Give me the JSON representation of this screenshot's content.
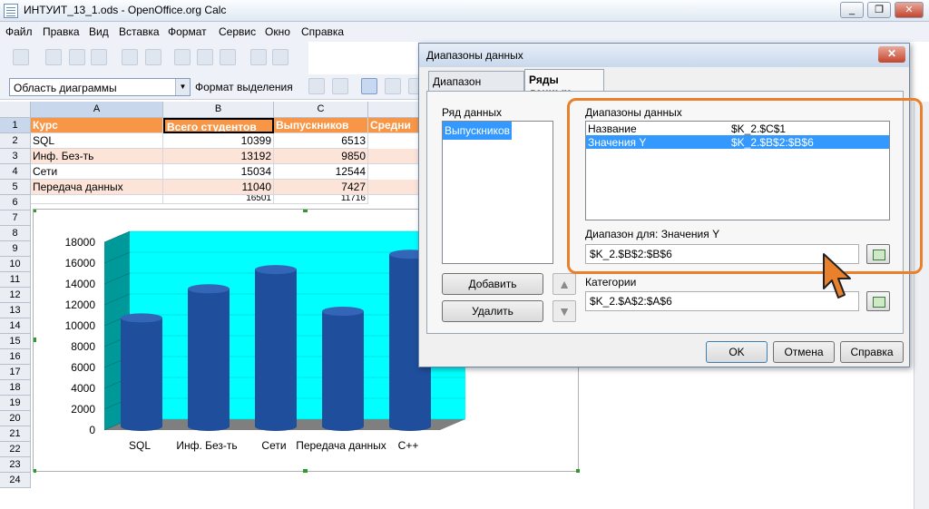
{
  "window": {
    "title": "ИНТУИТ_13_1.ods - OpenOffice.org Calc",
    "buttons": [
      "_",
      "❐",
      "✕"
    ]
  },
  "menu": [
    "Файл",
    "Правка",
    "Вид",
    "Вставка",
    "Формат",
    "Сервис",
    "Окно",
    "Справка"
  ],
  "toolbar2": {
    "element_combo": "Область диаграммы",
    "format_selection": "Формат выделения"
  },
  "sheet": {
    "columns": [
      "A",
      "B",
      "C"
    ],
    "rows": [
      "1",
      "2",
      "3",
      "4",
      "5",
      "6",
      "7",
      "8",
      "9",
      "10",
      "11",
      "12",
      "13",
      "14",
      "15",
      "16",
      "17",
      "18",
      "19",
      "20",
      "21",
      "22",
      "23",
      "24"
    ],
    "header": [
      "Курс",
      "Всего студентов",
      "Выпускников",
      "Средни"
    ],
    "data": [
      [
        "SQL",
        "10399",
        "6513"
      ],
      [
        "Инф. Без-ть",
        "13192",
        "9850"
      ],
      [
        "Сети",
        "15034",
        "12544"
      ],
      [
        "Передача данных",
        "11040",
        "7427"
      ],
      [
        "",
        "16501",
        "11716"
      ]
    ]
  },
  "chart_data": {
    "type": "bar",
    "categories": [
      "SQL",
      "Инф. Без-ть",
      "Сети",
      "Передача данных",
      "C++"
    ],
    "series": [
      {
        "values": [
          10399,
          13192,
          15034,
          11040,
          16501
        ]
      }
    ],
    "ylim": [
      0,
      18000
    ],
    "yticks": [
      "0",
      "2000",
      "4000",
      "6000",
      "8000",
      "10000",
      "12000",
      "14000",
      "16000",
      "18000"
    ],
    "colors": {
      "bar": "#1f4e9c",
      "wall": "#00ffff",
      "side_wall": "#009999",
      "floor": "#7f7f7f"
    }
  },
  "dialog": {
    "title": "Диапазоны данных",
    "close": "✕",
    "tabs": [
      "Диапазон данных",
      "Ряды данных"
    ],
    "series_label": "Ряд данных",
    "series_items": [
      "Выпускников"
    ],
    "ranges_label": "Диапазоны данных",
    "ranges": [
      {
        "name": "Название",
        "value": "$K_2.$C$1"
      },
      {
        "name": "Значения Y",
        "value": "$K_2.$B$2:$B$6"
      }
    ],
    "range_for_label": "Диапазон для: Значения Y",
    "range_for_value": "$K_2.$B$2:$B$6",
    "categories_label": "Категории",
    "categories_value": "$K_2.$A$2:$A$6",
    "add": "Добавить",
    "remove": "Удалить",
    "up": "▲",
    "down": "▼",
    "ok": "OK",
    "cancel": "Отмена",
    "help": "Справка"
  }
}
